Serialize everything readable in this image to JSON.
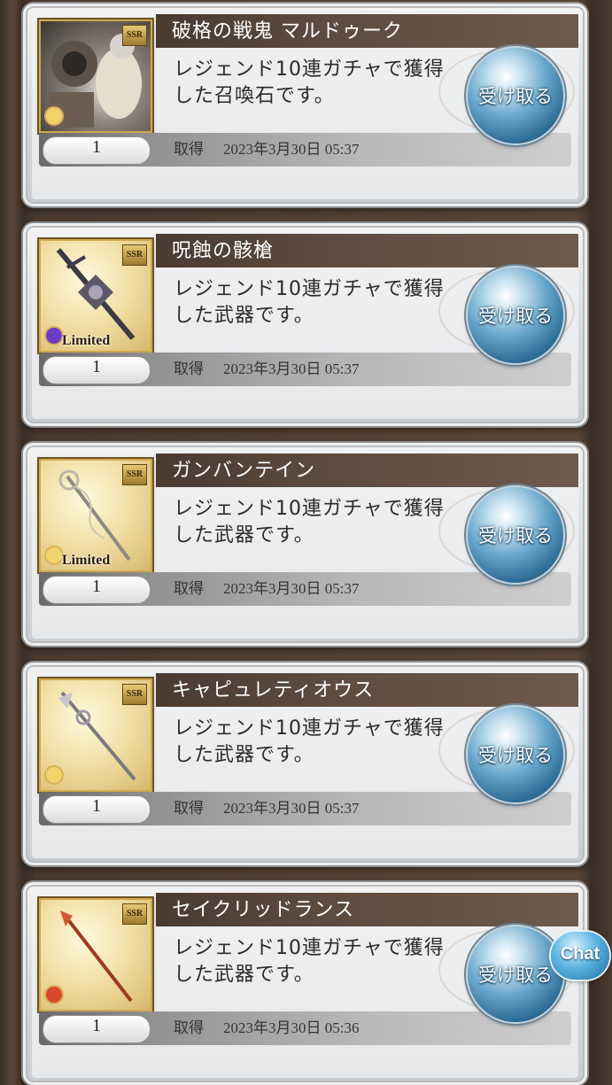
{
  "items": [
    {
      "title": "破格の戦鬼 マルドゥーク",
      "description": "レジェンド10連ガチャで獲得した召喚石です。",
      "quantity": "1",
      "acquired_label": "取得",
      "acquired_date": "2023年3月30日 05:37",
      "receive_label": "受け取る",
      "rarity": "SSR",
      "limited": "",
      "element": "light",
      "thumb_style": "dark"
    },
    {
      "title": "呪蝕の骸槍",
      "description": "レジェンド10連ガチャで獲得した武器です。",
      "quantity": "1",
      "acquired_label": "取得",
      "acquired_date": "2023年3月30日 05:37",
      "receive_label": "受け取る",
      "rarity": "SSR",
      "limited": "Limited",
      "element": "dark",
      "thumb_style": "gold"
    },
    {
      "title": "ガンバンテイン",
      "description": "レジェンド10連ガチャで獲得した武器です。",
      "quantity": "1",
      "acquired_label": "取得",
      "acquired_date": "2023年3月30日 05:37",
      "receive_label": "受け取る",
      "rarity": "SSR",
      "limited": "Limited",
      "element": "light",
      "thumb_style": "gold"
    },
    {
      "title": "キャピュレティオウス",
      "description": "レジェンド10連ガチャで獲得した武器です。",
      "quantity": "1",
      "acquired_label": "取得",
      "acquired_date": "2023年3月30日 05:37",
      "receive_label": "受け取る",
      "rarity": "SSR",
      "limited": "",
      "element": "light",
      "thumb_style": "gold"
    },
    {
      "title": "セイクリッドランス",
      "description": "レジェンド10連ガチャで獲得した武器です。",
      "quantity": "1",
      "acquired_label": "取得",
      "acquired_date": "2023年3月30日 05:36",
      "receive_label": "受け取る",
      "rarity": "SSR",
      "limited": "",
      "element": "fire",
      "thumb_style": "gold"
    }
  ],
  "chat_button": {
    "label": "Chat"
  },
  "colors": {
    "light": "#f1d36b",
    "dark": "#6a3bc8",
    "fire": "#d9482b",
    "accent": "#2c6c96"
  }
}
